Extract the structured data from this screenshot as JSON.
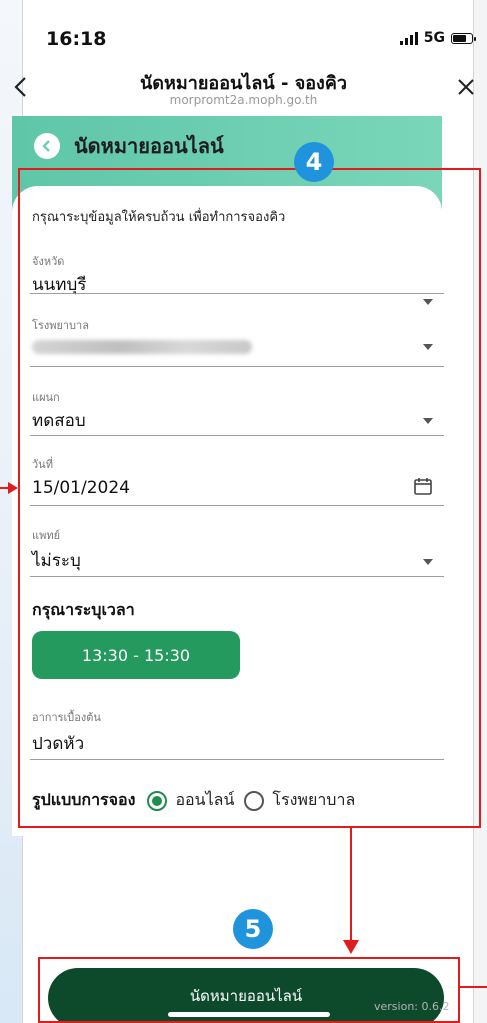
{
  "status_bar": {
    "time": "16:18",
    "network": "5G"
  },
  "nav": {
    "title": "นัดหมายออนไลน์ - จองคิว",
    "url": "morpromt2a.moph.go.th"
  },
  "banner": {
    "title": "นัดหมายออนไลน์"
  },
  "form": {
    "intro": "กรุณาระบุข้อมูลให้ครบถ้วน เพื่อทำการจองคิว",
    "province": {
      "label": "จังหวัด",
      "value": "นนทบุรี"
    },
    "hospital": {
      "label": "โรงพยาบาล",
      "value": ""
    },
    "department": {
      "label": "แผนก",
      "value": "ทดสอบ"
    },
    "date": {
      "label": "วันที่",
      "value": "15/01/2024"
    },
    "doctor": {
      "label": "แพทย์",
      "value": "ไม่ระบุ"
    },
    "time_prompt": "กรุณาระบุเวลา",
    "time_slot": "13:30 - 15:30",
    "symptom": {
      "label": "อาการเบื้องต้น",
      "value": "ปวดหัว"
    },
    "booking_type": {
      "label": "รูปแบบการจอง",
      "options": [
        "ออนไลน์",
        "โรงพยาบาล"
      ],
      "selected": "ออนไลน์"
    }
  },
  "submit_label": "นัดหมายออนไลน์",
  "version": "version: 0.6.2",
  "annotations": {
    "step_form": "4",
    "step_submit": "5"
  },
  "colors": {
    "accent": "#259a5f",
    "submit": "#0d4a2c",
    "banner": "#6dcfb1",
    "annotation": "#e21b1b",
    "badge": "#1f94dc"
  }
}
